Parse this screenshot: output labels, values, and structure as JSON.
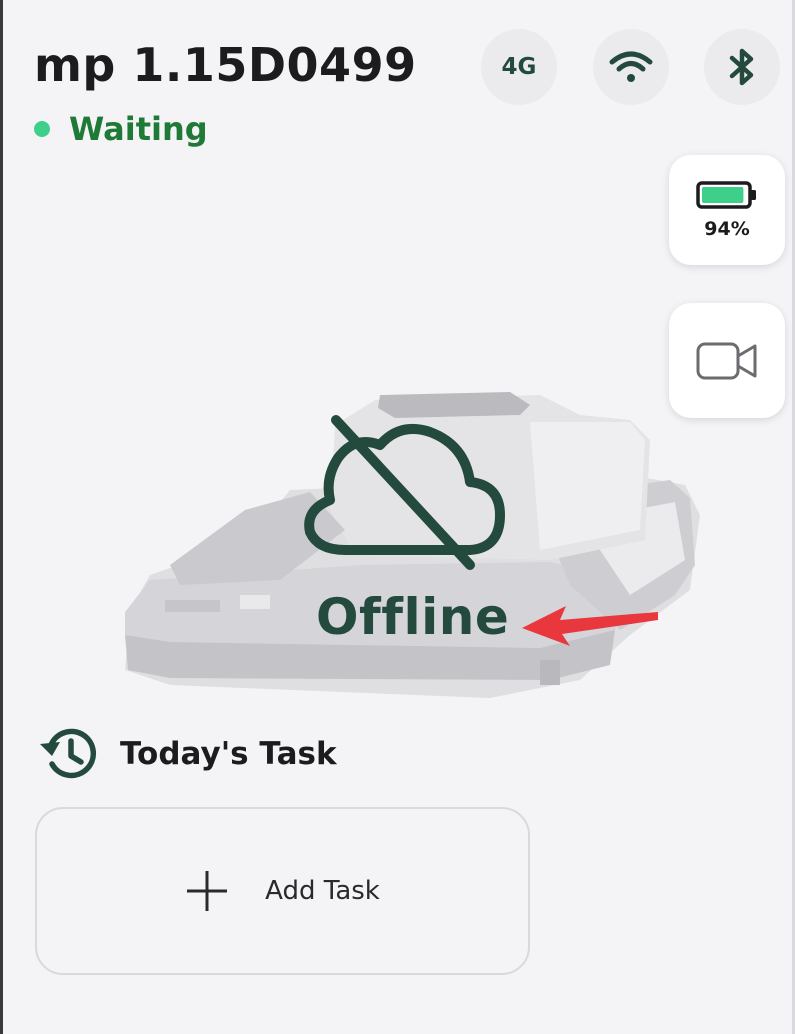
{
  "header": {
    "device_name": "mp 1.15D0499",
    "status": "Waiting",
    "status_color": "#3ed08a",
    "connectivity": [
      {
        "label": "4G",
        "icon": "cellular-4g-icon"
      },
      {
        "label": "",
        "icon": "wifi-icon"
      },
      {
        "label": "",
        "icon": "bluetooth-icon"
      }
    ]
  },
  "side": {
    "battery_percent": "94%",
    "battery_level": 0.94,
    "battery_color": "#3ed08a",
    "camera_icon": "video-camera-icon"
  },
  "stage": {
    "mower_icon": "mower-image",
    "offline_icon": "cloud-off-icon",
    "offline_text": "Offline",
    "annotation_color": "#e8383d"
  },
  "tasks": {
    "section_icon": "history-icon",
    "title": "Today's Task",
    "add_label": "Add Task",
    "add_icon": "plus-icon"
  },
  "colors": {
    "accent_dark": "#234a3c",
    "status_text": "#1f7a37",
    "background": "#f4f4f7"
  }
}
